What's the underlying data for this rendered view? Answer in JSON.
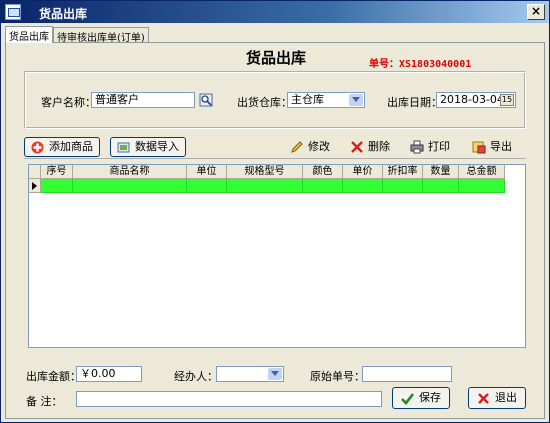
{
  "window": {
    "title": "货品出库"
  },
  "tabs": [
    {
      "label": "货品出库",
      "active": true
    },
    {
      "label": "待审核出库单(订单)",
      "active": false
    }
  ],
  "form": {
    "title": "货品出库",
    "order_no_label": "单号：",
    "order_no_value": "XS1803040001"
  },
  "header_fields": {
    "customer_label": "客户名称：",
    "customer_value": "普通客户",
    "warehouse_label": "出货仓库：",
    "warehouse_value": "主仓库",
    "date_label": "出库日期：",
    "date_value": "2018-03-04"
  },
  "toolbar": {
    "add_product": "添加商品",
    "import_data": "数据导入",
    "edit": "修改",
    "delete": "删除",
    "print": "打印",
    "export": "导出"
  },
  "table": {
    "columns": [
      "序号",
      "商品名称",
      "单位",
      "规格型号",
      "颜色",
      "单价",
      "折扣率",
      "数量",
      "总金额"
    ],
    "rows": [
      [
        "",
        "",
        "",
        "",
        "",
        "",
        "",
        "",
        ""
      ]
    ]
  },
  "footer": {
    "amount_label": "出库金额：",
    "amount_value": "￥0.00",
    "handler_label": "经办人：",
    "handler_value": "",
    "original_no_label": "原始单号：",
    "original_no_value": "",
    "remark_label": "备    注：",
    "remark_value": "",
    "save": "保存",
    "exit": "退出"
  },
  "colors": {
    "title_bar": "#0a246a",
    "order_no": "#e00000",
    "row_highlight": "#32ff32"
  }
}
